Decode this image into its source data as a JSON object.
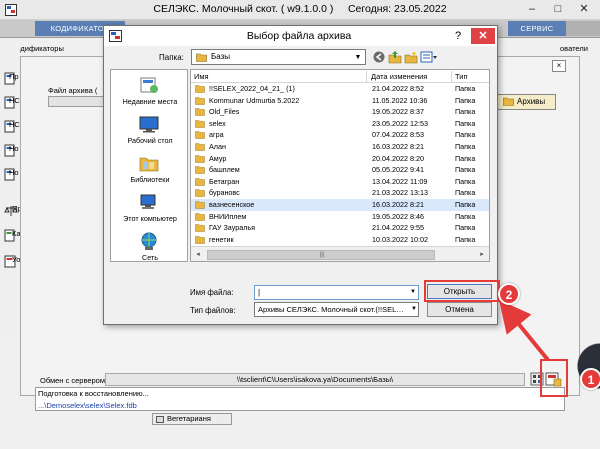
{
  "app": {
    "title": "СЕЛЭКС. Молочный скот. ( w9.1.0.0 )",
    "today": "Сегодня: 23.05.2022",
    "controls": {
      "minimize": "–",
      "maximize": "□",
      "close": "✕"
    },
    "menu": [
      "КОДИФИКАТОР",
      "СЕРВИС"
    ],
    "strip_label": "Кодификаторы",
    "strip_label_right": "ователи",
    "strip_items": [
      "Пр",
      "НС",
      "НС",
      "Но",
      "Но",
      "Пр",
      "Ка",
      "Уо"
    ],
    "mid_close": "×",
    "archive_label": "Файл архива (",
    "archives_button": "Архивы",
    "server_label": "Обмен с сервером",
    "server_path": "\\\\tsclient\\C\\Users\\isakova.ya\\Documents\\Базы\\",
    "status_text": "Подготовка к восстановлению...",
    "db_path": "...\\Demoselex\\selex\\Selex.fdb",
    "veg_button": "Вегетарианя"
  },
  "dialog": {
    "title": "Выбор файла архива",
    "help": "?",
    "close": "✕",
    "folder_label": "Папка:",
    "folder_value": "Базы",
    "toolbar_icons": [
      "back-icon",
      "up-folder-icon",
      "new-folder-icon",
      "view-menu-icon"
    ],
    "places": [
      "Недавние места",
      "Рабочий стол",
      "Библиотеки",
      "Этот компьютер",
      "Сеть"
    ],
    "columns": [
      "Имя",
      "Дата изменения",
      "Тип"
    ],
    "files": [
      {
        "name": "!!SELEX_2022_04_21_ (1)",
        "date": "21.04.2022 8:52",
        "type": "Папка"
      },
      {
        "name": "Kommunar Udmurtia 5.2022",
        "date": "11.05.2022 10:36",
        "type": "Папка"
      },
      {
        "name": "Old_Files",
        "date": "19.05.2022 8:37",
        "type": "Папка"
      },
      {
        "name": "selex",
        "date": "23.05.2022 12:53",
        "type": "Папка"
      },
      {
        "name": "агра",
        "date": "07.04.2022 8:53",
        "type": "Папка"
      },
      {
        "name": "Алан",
        "date": "16.03.2022 8:21",
        "type": "Папка"
      },
      {
        "name": "Амур",
        "date": "20.04.2022 8:20",
        "type": "Папка"
      },
      {
        "name": "башплем",
        "date": "05.05.2022 9:41",
        "type": "Папка"
      },
      {
        "name": "Бетагран",
        "date": "13.04.2022 11:09",
        "type": "Папка"
      },
      {
        "name": "бурановс",
        "date": "21.03.2022 13:13",
        "type": "Папка"
      },
      {
        "name": "вазнесенское",
        "date": "16.03.2022 8:21",
        "type": "Папка"
      },
      {
        "name": "ВНИИплем",
        "date": "19.05.2022 8:46",
        "type": "Папка"
      },
      {
        "name": "ГАУ Зауралья",
        "date": "21.04.2022 9:55",
        "type": "Папка"
      },
      {
        "name": "генетик",
        "date": "10.03.2022 10:02",
        "type": "Папка"
      },
      {
        "name": "ГКУ ГГСХУ",
        "date": "25.04.2022 15:42",
        "type": "Папка"
      }
    ],
    "selected_index": 10,
    "scroll_left": "◂",
    "scroll_right": "▸",
    "scroll_grip": "|||",
    "filename_label": "Имя файла:",
    "filename_value": "|",
    "filetype_label": "Тип файлов:",
    "filetype_value": "Архивы СЕЛЭКС. Молочный скот.(!!SELEX*.j",
    "open_button": "Открыть",
    "cancel_button": "Отмена"
  },
  "annotations": {
    "badge1": "1",
    "badge2": "2",
    "color": "#e53a3a"
  },
  "colors": {
    "menu_active": "#5b7fb4",
    "selection": "#d9e8fb",
    "folder": "#e7b73f"
  }
}
